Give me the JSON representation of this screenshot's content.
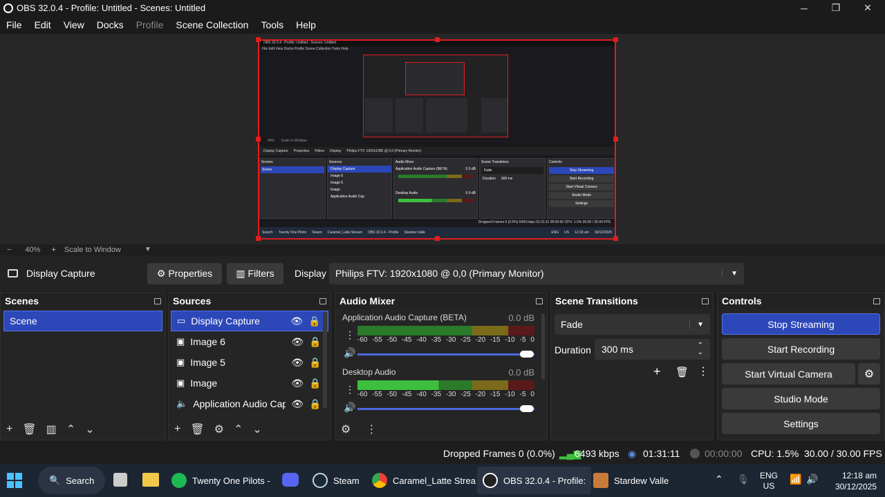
{
  "window": {
    "title": "OBS 32.0.4 - Profile: Untitled - Scenes: Untitled",
    "minimize": "─",
    "maximize": "❐",
    "close": "✕"
  },
  "menu": [
    "File",
    "Edit",
    "View",
    "Docks",
    "Profile",
    "Scene Collection",
    "Tools",
    "Help"
  ],
  "mini": {
    "title": "OBS 32.0.4 - Profile: Untitled - Scenes: Untitled",
    "menu": "File  Edit  View  Docks  Profile  Scene Collection  Tools  Help",
    "source": "Display Capture",
    "properties": "Properties",
    "filters": "Filters",
    "display_label": "Display",
    "display_value": "Philips FTV: 1920x1080 @ 0,0 (Primary Monitor)",
    "scenes": "Scenes",
    "sources": "Sources",
    "mixer": "Audio Mixer",
    "transitions": "Scene Transitions",
    "controls": "Controls",
    "scene": "Scene",
    "src_items": [
      "Display Capture",
      "Image 6",
      "Image 5",
      "Image",
      "Application Audio Cap"
    ],
    "stop": "Stop Streaming",
    "start_rec": "Start Recording",
    "start_vc": "Start Virtual Camera",
    "studio": "Studio Mode",
    "settings": "Settings",
    "fade": "Fade",
    "duration": "Duration",
    "duration_val": "300 ms",
    "app_audio": "Application Audio Capture (BETA)",
    "desk_audio": "Desktop Audio",
    "db": "0.0 dB",
    "status": "Dropped Frames 0 (0.0%)   6493 kbps   01:31:11   00:00:00   CPU: 1.5%   30.00 / 30.00 FPS",
    "taskbar": [
      "Search",
      "Twenty One Pilots",
      "Steam",
      "Caramel_Latte Stream",
      "OBS 32.0.4 - Profile",
      "Stardew Valle"
    ],
    "tray_lang": "ENG",
    "tray_region": "US",
    "time": "12:18 am",
    "date": "30/12/2025",
    "zoom": "40%",
    "scale": "Scale to Window"
  },
  "zoom": {
    "minus": "−",
    "value": "40%",
    "plus": "+",
    "scale": "Scale to Window"
  },
  "sourcebar": {
    "name": "Display Capture",
    "properties": "Properties",
    "filters": "Filters",
    "display_label": "Display",
    "display_value": "Philips FTV: 1920x1080 @ 0,0 (Primary Monitor)"
  },
  "scenes": {
    "title": "Scenes",
    "items": [
      "Scene"
    ]
  },
  "sources": {
    "title": "Sources",
    "items": [
      "Display Capture",
      "Image 6",
      "Image 5",
      "Image",
      "Application Audio Cap"
    ]
  },
  "mixer": {
    "title": "Audio Mixer",
    "channels": [
      {
        "name": "Application Audio Capture (BETA)",
        "db": "0.0 dB",
        "level": 0.0
      },
      {
        "name": "Desktop Audio",
        "db": "0.0 dB",
        "level": 0.46
      }
    ],
    "scale": [
      "-60",
      "-55",
      "-50",
      "-45",
      "-40",
      "-35",
      "-30",
      "-25",
      "-20",
      "-15",
      "-10",
      "-5",
      "0"
    ]
  },
  "transitions": {
    "title": "Scene Transitions",
    "type": "Fade",
    "duration_label": "Duration",
    "duration": "300 ms"
  },
  "controls": {
    "title": "Controls",
    "stop_streaming": "Stop Streaming",
    "start_recording": "Start Recording",
    "start_virtual_camera": "Start Virtual Camera",
    "studio_mode": "Studio Mode",
    "settings": "Settings"
  },
  "status": {
    "dropped": "Dropped Frames 0 (0.0%)",
    "kbps": "6493 kbps",
    "stream_time": "01:31:11",
    "rec_time": "00:00:00",
    "cpu": "CPU: 1.5%",
    "fps": "30.00 / 30.00 FPS"
  },
  "taskbar": {
    "search": "Search",
    "apps": [
      "Twenty One Pilots -",
      "Steam",
      "Caramel_Latte Strea",
      "OBS 32.0.4 - Profile:",
      "Stardew Valle"
    ],
    "lang": "ENG",
    "region": "US",
    "time": "12:18 am",
    "date": "30/12/2025"
  },
  "colors": {
    "accent": "#2c47b8",
    "selection": "#e01e1e",
    "meter_green": "#3dbf3d",
    "meter_yellow": "#b8a02a",
    "meter_red": "#8e1c1c"
  }
}
